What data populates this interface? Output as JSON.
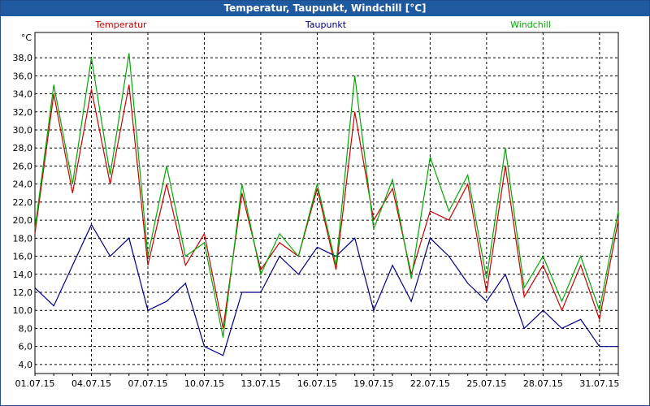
{
  "window": {
    "title": "Temperatur, Taupunkt, Windchill [°C]"
  },
  "chart_data": {
    "type": "line",
    "title": "Temperatur, Taupunkt, Windchill [°C]",
    "ylabel": "°C",
    "ylim": [
      3.0,
      40.8
    ],
    "yticks": [
      4.0,
      6.0,
      8.0,
      10.0,
      12.0,
      14.0,
      16.0,
      18.0,
      20.0,
      22.0,
      24.0,
      26.0,
      28.0,
      30.0,
      32.0,
      34.0,
      36.0,
      38.0
    ],
    "ytick_labels": [
      "4,0",
      "6,0",
      "8,0",
      "10,0",
      "12,0",
      "14,0",
      "16,0",
      "18,0",
      "20,0",
      "22,0",
      "24,0",
      "26,0",
      "28,0",
      "30,0",
      "32,0",
      "34,0",
      "36,0",
      "38,0"
    ],
    "xlim": [
      "01.07.15",
      "01.08.15"
    ],
    "xticks": [
      "01.07.15",
      "04.07.15",
      "07.07.15",
      "10.07.15",
      "13.07.15",
      "16.07.15",
      "19.07.15",
      "22.07.15",
      "25.07.15",
      "28.07.15",
      "31.07.15"
    ],
    "grid": true,
    "legend_position": "top",
    "x": [
      "01.07.15",
      "02.07.15",
      "03.07.15",
      "04.07.15",
      "05.07.15",
      "06.07.15",
      "07.07.15",
      "08.07.15",
      "09.07.15",
      "10.07.15",
      "11.07.15",
      "12.07.15",
      "13.07.15",
      "14.07.15",
      "15.07.15",
      "16.07.15",
      "17.07.15",
      "18.07.15",
      "19.07.15",
      "20.07.15",
      "21.07.15",
      "22.07.15",
      "23.07.15",
      "24.07.15",
      "25.07.15",
      "26.07.15",
      "27.07.15",
      "28.07.15",
      "29.07.15",
      "30.07.15",
      "31.07.15",
      "01.08.15"
    ],
    "series": [
      {
        "name": "Temperatur",
        "color": "#cc0000",
        "values": [
          18.5,
          34.0,
          23.0,
          34.5,
          24.0,
          35.0,
          15.0,
          24.0,
          15.0,
          18.5,
          8.0,
          23.0,
          14.5,
          17.5,
          16.0,
          23.5,
          14.5,
          32.0,
          20.0,
          23.5,
          14.0,
          21.0,
          20.0,
          24.0,
          12.0,
          26.0,
          11.5,
          15.0,
          10.0,
          15.0,
          9.0,
          20.0
        ]
      },
      {
        "name": "Taupunkt",
        "color": "#00008b",
        "values": [
          12.5,
          10.5,
          15.0,
          19.5,
          16.0,
          18.0,
          10.0,
          11.0,
          13.0,
          6.0,
          5.0,
          12.0,
          12.0,
          16.0,
          14.0,
          17.0,
          16.0,
          18.0,
          10.0,
          15.0,
          11.0,
          18.0,
          16.0,
          13.0,
          11.0,
          14.0,
          8.0,
          10.0,
          8.0,
          9.0,
          6.0,
          6.0
        ]
      },
      {
        "name": "Windchill",
        "color": "#00aa00",
        "values": [
          19.0,
          35.0,
          24.0,
          38.0,
          25.0,
          38.5,
          16.0,
          26.0,
          16.0,
          17.5,
          7.0,
          24.0,
          14.0,
          18.5,
          16.0,
          24.0,
          15.0,
          36.0,
          19.0,
          24.5,
          13.5,
          27.0,
          21.0,
          25.0,
          13.5,
          28.0,
          12.5,
          16.0,
          11.0,
          16.0,
          10.0,
          21.0
        ]
      }
    ]
  }
}
